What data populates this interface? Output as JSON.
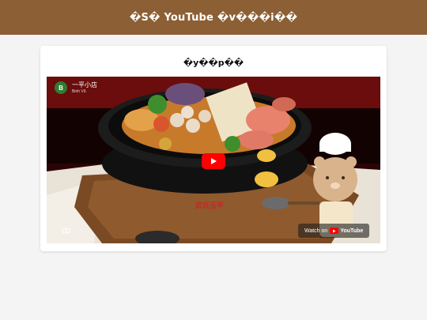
{
  "header": {
    "title": "�S� YouTube �v���i��"
  },
  "card": {
    "title": "�y��p��"
  },
  "video": {
    "channel_initial": "B",
    "channel_name": "一平小店",
    "channel_sub": "Binh Vũ",
    "brand_text": "武氏玉平",
    "watch_label": "Watch on",
    "yt_word": "YouTube"
  },
  "colors": {
    "header_bg": "#8c5f34",
    "page_bg": "#f4f4f4",
    "play_red": "#ff0000"
  },
  "icons": [
    "play-icon",
    "link-icon",
    "youtube-logo-icon"
  ]
}
